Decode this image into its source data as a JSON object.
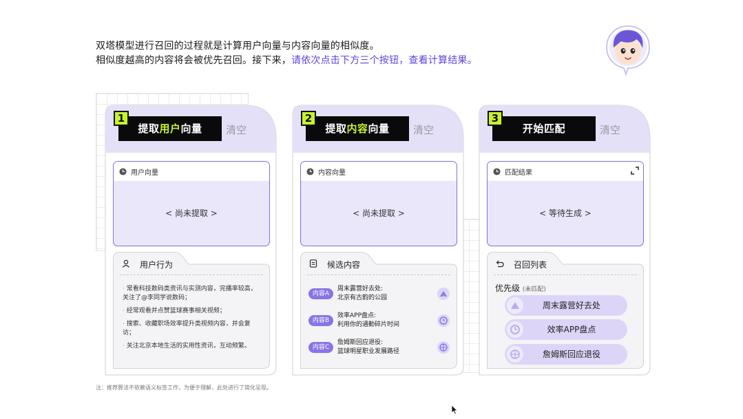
{
  "intro": {
    "line1": "双塔模型进行召回的过程就是计算用户向量与内容向量的相似度。",
    "line2_prefix": "相似度越高的内容将会被优先召回。接下来，",
    "line2_highlight": "请依次点击下方三个按钮，查看计算结果。"
  },
  "cards": {
    "user": {
      "step": "1",
      "action_pre": "提取",
      "action_hl": "用户",
      "action_post": "向量",
      "clear": "清空",
      "result_title": "用户向量",
      "result_text": "< 尚未提取 >",
      "lower_title": "用户行为",
      "behaviors": [
        "常看科技数码类资讯与实测内容，完播率较高，关注了@李同学说数码；",
        "经常观看并点赞篮球赛事相关视频；",
        "搜索、收藏职场效率提升类视频内容，并会复访；",
        "关注北京本地生活的实用性资讯，互动频繁。"
      ]
    },
    "content": {
      "step": "2",
      "action_pre": "提取",
      "action_hl": "内容",
      "action_post": "向量",
      "clear": "清空",
      "result_title": "内容向量",
      "result_text": "< 尚未提取 >",
      "lower_title": "候选内容",
      "candidates": [
        {
          "tag": "内容A",
          "line1": "周末露营好去处:",
          "line2": "北京有古韵的公园",
          "icon": "camping-icon"
        },
        {
          "tag": "内容B",
          "line1": "效率APP盘点:",
          "line2": "利用你的通勤碎片时间",
          "icon": "clock-icon"
        },
        {
          "tag": "内容C",
          "line1": "詹姆斯回应退役:",
          "line2": "篮球明星职业发展路径",
          "icon": "basketball-icon"
        }
      ]
    },
    "match": {
      "step": "3",
      "action": "开始匹配",
      "clear": "清空",
      "result_title": "匹配结果",
      "result_text": "< 等待生成 >",
      "lower_title": "召回列表",
      "priority_label": "优先级",
      "priority_note": "(未匹配)",
      "recall_list": [
        {
          "label": "周末露营好去处",
          "icon": "camping-icon"
        },
        {
          "label": "效率APP盘点",
          "icon": "clock-icon"
        },
        {
          "label": "詹姆斯回应退役",
          "icon": "basketball-icon"
        }
      ]
    }
  },
  "footnote": "注：推荐算法不依赖语义标签工作，为便于理解，此处进行了简化呈现。",
  "colors": {
    "accent": "#5a46e0",
    "lime": "#c6f22e",
    "card_bg": "#e4e0f8",
    "result_bg": "#ebe7fb",
    "pill_bg": "#ddd5f8",
    "tag_bg": "#8a74e6"
  }
}
